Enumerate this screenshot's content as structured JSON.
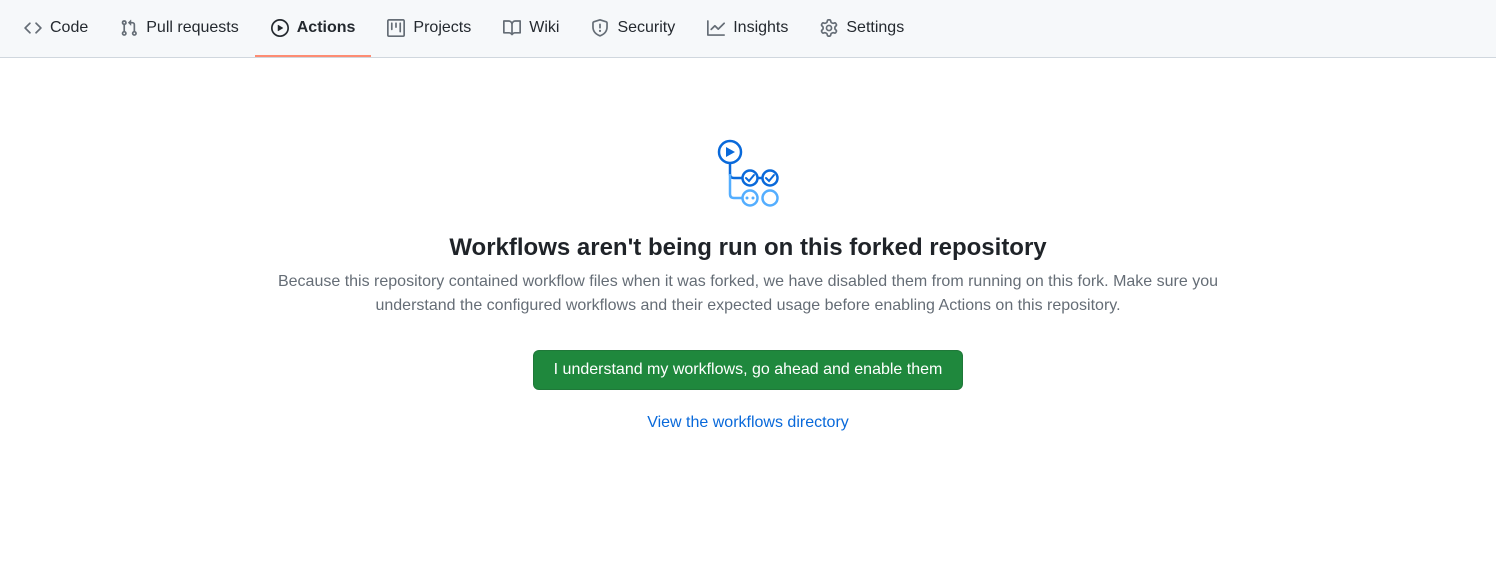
{
  "tabs": {
    "code": "Code",
    "pull_requests": "Pull requests",
    "actions": "Actions",
    "projects": "Projects",
    "wiki": "Wiki",
    "security": "Security",
    "insights": "Insights",
    "settings": "Settings"
  },
  "blankslate": {
    "heading": "Workflows aren't being run on this forked repository",
    "description": "Because this repository contained workflow files when it was forked, we have disabled them from running on this fork. Make sure you understand the configured workflows and their expected usage before enabling Actions on this repository.",
    "enable_button": "I understand my workflows, go ahead and enable them",
    "view_link": "View the workflows directory"
  }
}
